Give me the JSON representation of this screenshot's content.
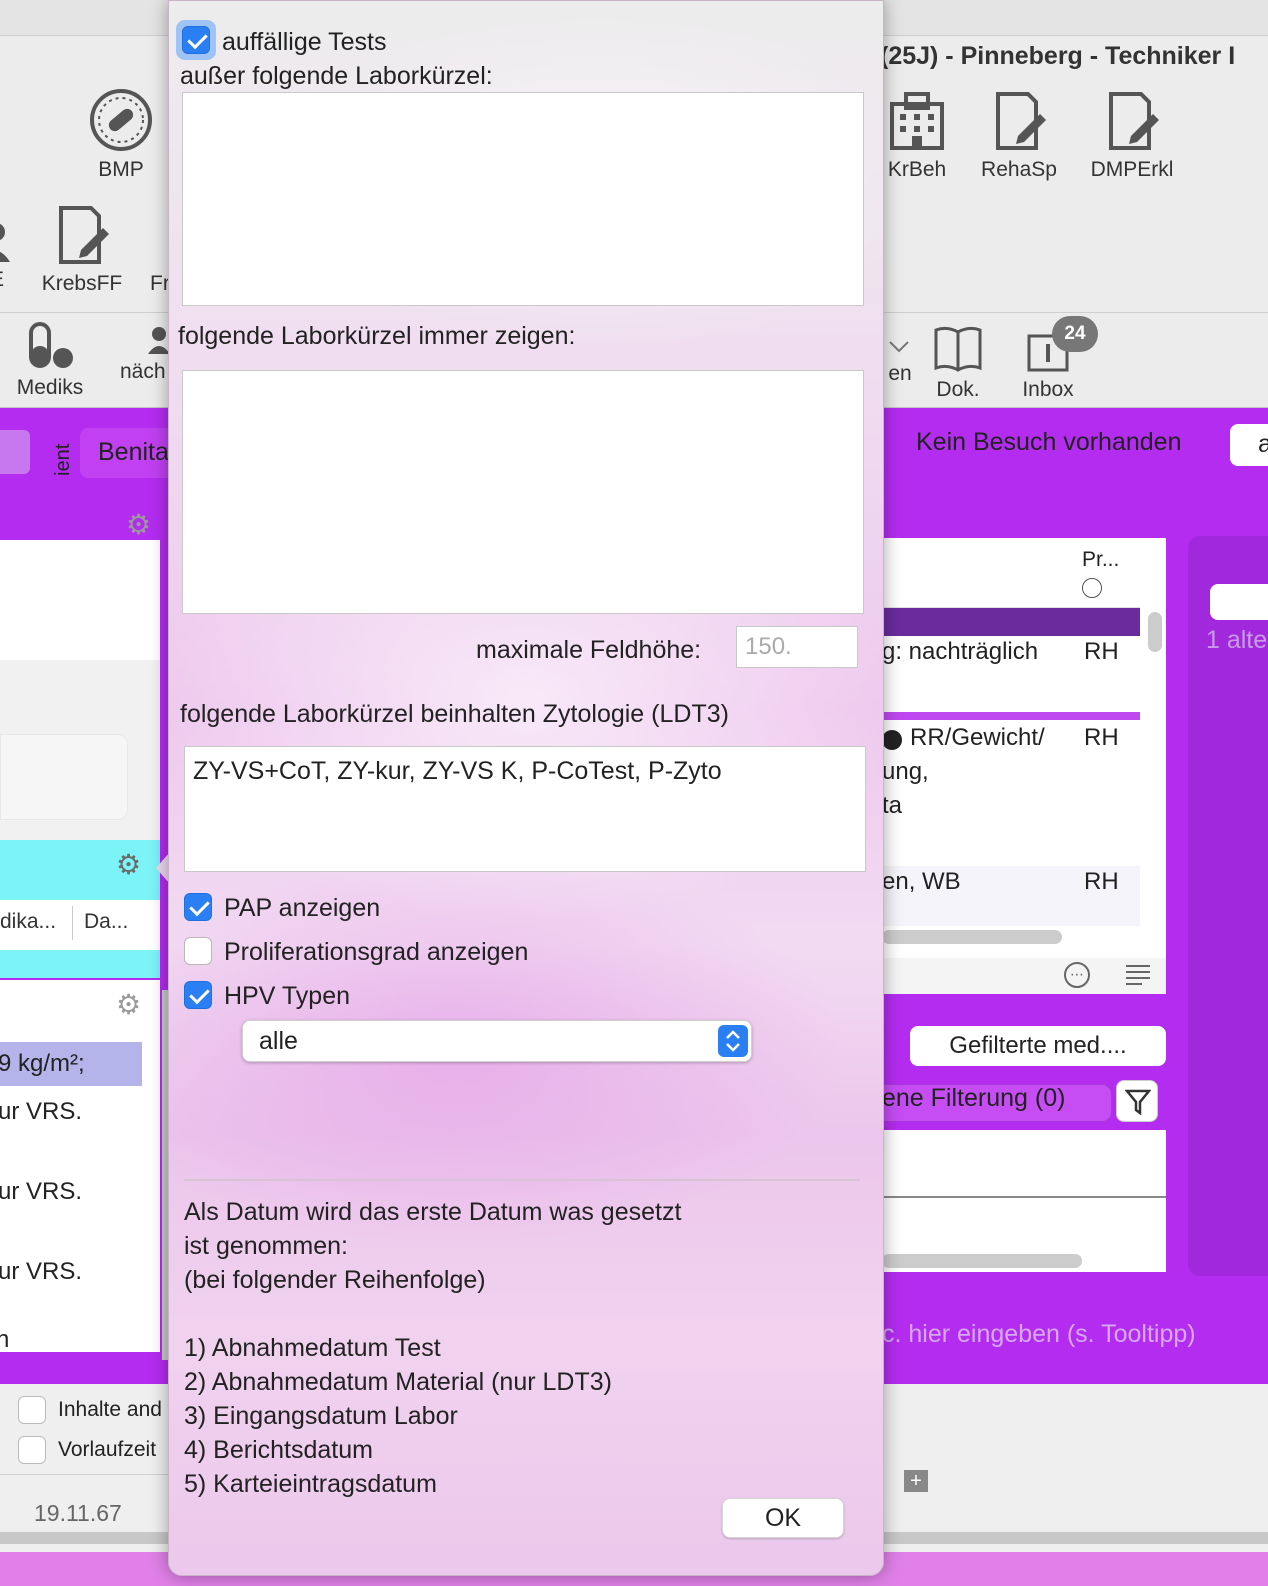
{
  "background": {
    "window_title": "(25J) - Pinneberg - Techniker I",
    "toolbar_row1": [
      {
        "label": "BMP",
        "icon": "pill-dial-icon"
      },
      {
        "label": "KrBeh",
        "icon": "hospital-icon"
      },
      {
        "label": "RehaSp",
        "icon": "form-edit-icon"
      },
      {
        "label": "DMPErkl",
        "icon": "form-edit-icon"
      }
    ],
    "toolbar_row2": [
      {
        "label": "E",
        "icon": "person-icon"
      },
      {
        "label": "KrebsFF",
        "icon": "form-edit-icon"
      },
      {
        "label": "Fr",
        "icon": ""
      }
    ],
    "toolbar_row3": [
      {
        "label": "Mediks",
        "icon": "medication-icon"
      },
      {
        "label": "näch",
        "icon": "person-icon"
      },
      {
        "label": "en",
        "icon": "chevron-down-icon"
      },
      {
        "label": "Dok.",
        "icon": "book-icon"
      },
      {
        "label": "Inbox",
        "icon": "inbox-icon"
      }
    ],
    "inbox_badge": "24",
    "left_tab_vertical": "ient",
    "left_tab_label": "Benita",
    "visit_status": "Kein Besuch vorhanden",
    "right_input_text": "a",
    "cyan_headers": [
      "dika...",
      "Da..."
    ],
    "left_list": [
      "9 kg/m²;",
      "ur VRS.",
      "ur VRS.",
      "ur VRS.",
      "n"
    ],
    "right_header": "Pr...",
    "right_rows": [
      {
        "text": "g: nachträglich",
        "code": "RH"
      },
      {
        "text": "RR/Gewicht/",
        "code": "RH"
      },
      {
        "text": "ung,",
        "code": ""
      },
      {
        "text": "ta",
        "code": ""
      },
      {
        "text": "en, WB",
        "code": "RH"
      }
    ],
    "side_text": "1 alte",
    "filter_button": "Gefilterte med....",
    "filter_label": "ene Filterung (0)",
    "hint_placeholder": "c. hier eingeben (s. Tooltipp)",
    "bottom_checkboxes": [
      "Inhalte and",
      "Vorlaufzeit"
    ],
    "bottom_date": "19.11.67"
  },
  "dialog": {
    "auffaellige_tests": {
      "label": "auffällige Tests",
      "checked": true
    },
    "exclude_label": "außer folgende Laborkürzel:",
    "exclude_value": "",
    "always_show_label": "folgende Laborkürzel immer zeigen:",
    "always_show_value": "",
    "max_height_label": "maximale Feldhöhe:",
    "max_height_placeholder": "150.",
    "cytology_label": "folgende Laborkürzel beinhalten Zytologie (LDT3)",
    "cytology_value": "ZY-VS+CoT, ZY-kur, ZY-VS K, P-CoTest, P-Zyto",
    "pap": {
      "label": "PAP anzeigen",
      "checked": true
    },
    "proliferation": {
      "label": "Proliferationsgrad anzeigen",
      "checked": false
    },
    "hpv": {
      "label": "HPV Typen",
      "checked": true
    },
    "hpv_select_value": "alle",
    "info_lines": [
      "Als Datum wird das erste Datum was gesetzt",
      "ist genommen:",
      "(bei folgender Reihenfolge)",
      "",
      "1) Abnahmedatum Test",
      "2) Abnahmedatum Material (nur LDT3)",
      "3) Eingangsdatum Labor",
      "4) Berichtsdatum",
      "5) Karteieintragsdatum"
    ],
    "ok_label": "OK"
  }
}
